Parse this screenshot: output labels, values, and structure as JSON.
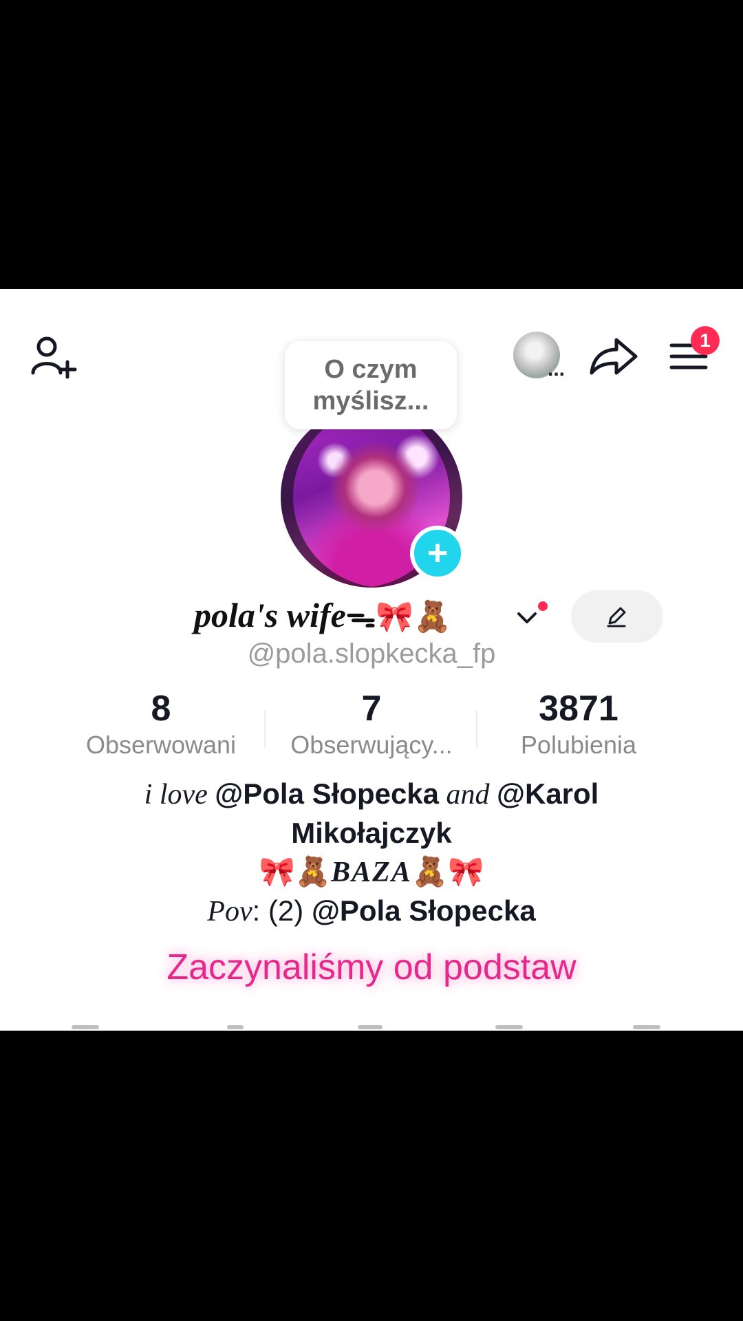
{
  "header": {
    "thought_bubble": "O czym\nmyślisz...",
    "mini_avatar_label": "...",
    "notification_count": "1"
  },
  "profile": {
    "display_name": "pola's wife",
    "emoji_suffix": "ᯓ🎀🧸",
    "username": "@pola.slopkecka_fp",
    "avatar_add": "+"
  },
  "stats": [
    {
      "value": "8",
      "label": "Obserwowani"
    },
    {
      "value": "7",
      "label": "Obserwujący..."
    },
    {
      "value": "3871",
      "label": "Polubienia"
    }
  ],
  "bio": {
    "line1_prefix": "i love ",
    "line1_mention1": "@Pola Słopecka",
    "line1_and": " and ",
    "line1_mention2": "@Karol Mikołajczyk",
    "line2_left": "🎀🧸",
    "line2_word": "BAZA",
    "line2_right": "🧸🎀",
    "line3_prefix": "Pov",
    "line3_rest": ": (2) ",
    "line3_mention": "@Pola Słopecka"
  },
  "caption": "Zaczynaliśmy od podstaw",
  "colors": {
    "accent": "#fe2c55",
    "plus": "#20d5ec",
    "caption": "#e8278d"
  },
  "icons": [
    "add-friend-icon",
    "share-icon",
    "menu-icon",
    "chevron-down-icon",
    "pencil-icon",
    "plus-icon"
  ]
}
